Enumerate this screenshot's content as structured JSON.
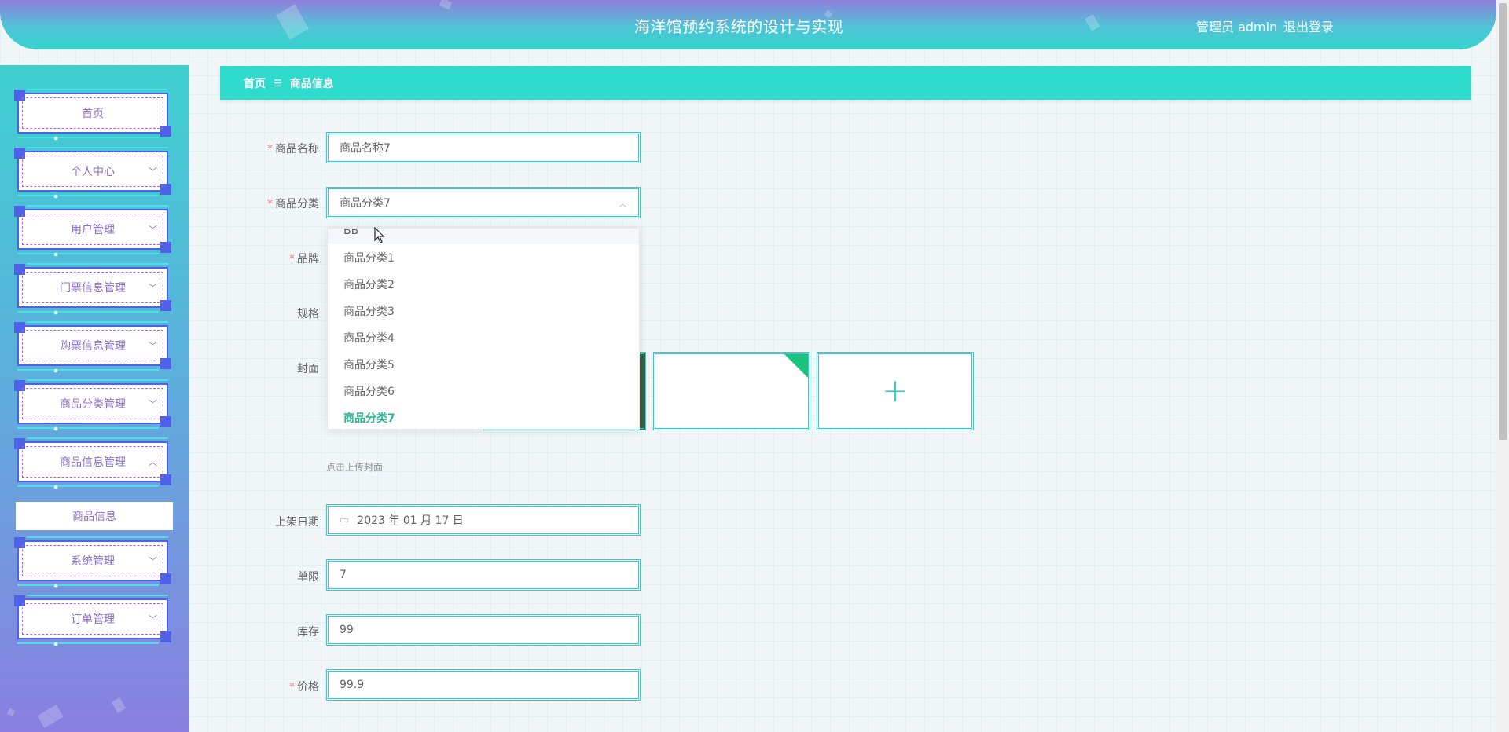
{
  "header": {
    "title": "海洋馆预约系统的设计与实现",
    "user": "管理员 admin",
    "logout": "退出登录"
  },
  "sidebar": {
    "items": [
      {
        "label": "首页",
        "expandable": false
      },
      {
        "label": "个人中心",
        "expandable": true
      },
      {
        "label": "用户管理",
        "expandable": true
      },
      {
        "label": "门票信息管理",
        "expandable": true
      },
      {
        "label": "购票信息管理",
        "expandable": true
      },
      {
        "label": "商品分类管理",
        "expandable": true
      },
      {
        "label": "商品信息管理",
        "expandable": true,
        "expanded": true
      },
      {
        "label": "系统管理",
        "expandable": true
      },
      {
        "label": "订单管理",
        "expandable": true
      }
    ],
    "submenu": {
      "label": "商品信息"
    }
  },
  "breadcrumb": {
    "home": "首页",
    "separator": "☰",
    "current": "商品信息"
  },
  "form": {
    "name": {
      "label": "商品名称",
      "required": true,
      "value": "商品名称7"
    },
    "category": {
      "label": "商品分类",
      "required": true,
      "value": "商品分类7"
    },
    "brand": {
      "label": "品牌",
      "required": true
    },
    "spec": {
      "label": "规格",
      "required": false
    },
    "cover": {
      "label": "封面",
      "required": false,
      "hint": "点击上传封面"
    },
    "date": {
      "label": "上架日期",
      "required": false,
      "value": "2023 年 01 月 17 日"
    },
    "limit": {
      "label": "单限",
      "required": false,
      "value": "7"
    },
    "stock": {
      "label": "库存",
      "required": false,
      "value": "99"
    },
    "price": {
      "label": "价格",
      "required": true,
      "value": "99.9"
    }
  },
  "dropdown": {
    "options": [
      "BB",
      "商品分类1",
      "商品分类2",
      "商品分类3",
      "商品分类4",
      "商品分类5",
      "商品分类6",
      "商品分类7"
    ],
    "selected": "商品分类7"
  },
  "colors": {
    "accent": "#2edbcd",
    "menu_border": "#4d62e6",
    "selected_option": "#2ab58f",
    "required": "#f56c6c"
  }
}
